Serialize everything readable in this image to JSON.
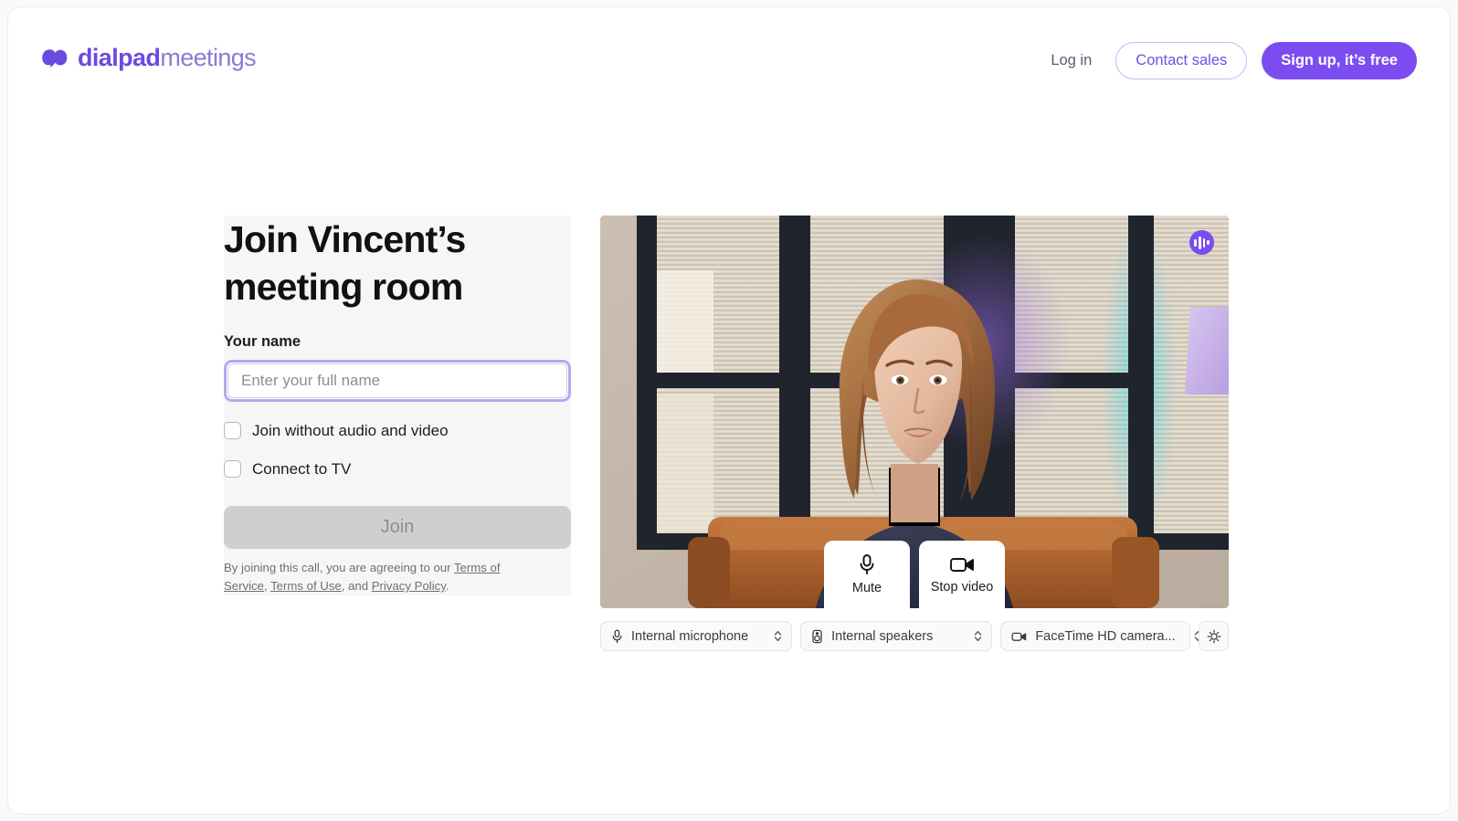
{
  "header": {
    "logo": {
      "icon": "dialpad-logo-icon",
      "bold_text": "dialpad",
      "light_text": "meetings"
    },
    "login_label": "Log in",
    "contact_sales_label": "Contact sales",
    "signup_label": "Sign up, it’s free"
  },
  "join_panel": {
    "title": "Join Vincent’s meeting room",
    "name_label": "Your name",
    "name_value": "",
    "name_placeholder": "Enter your full name",
    "checkboxes": [
      {
        "label": "Join without audio and video",
        "checked": false
      },
      {
        "label": "Connect to TV",
        "checked": false
      }
    ],
    "join_button_label": "Join",
    "join_button_enabled": false,
    "terms": {
      "intro": "By joining this call, you are agreeing to our",
      "link_terms_of_service": "Terms of Service",
      "separator_1": ", ",
      "link_terms_of_use": "Terms of Use",
      "separator_2": ", and ",
      "link_privacy_policy": "Privacy Policy",
      "end": "."
    }
  },
  "video": {
    "audio_indicator_icon": "audio-level-icon",
    "controls": [
      {
        "label": "Mute",
        "icon": "microphone-icon"
      },
      {
        "label": "Stop video",
        "icon": "video-camera-icon"
      }
    ],
    "devices": [
      {
        "icon": "microphone-icon",
        "value": "Internal microphone"
      },
      {
        "icon": "speaker-icon",
        "value": "Internal speakers"
      },
      {
        "icon": "camera-icon",
        "value": "FaceTime HD camera..."
      }
    ],
    "effects_button_icon": "video-effects-icon"
  },
  "colors": {
    "brand_purple": "#7b4df0",
    "logo_bold": "#6b4ae0",
    "logo_light": "#8d79d6",
    "focus_ring": "#b9a5ef",
    "panel_bg": "#f7f6f7",
    "page_bg": "#ffffff",
    "disabled_button": "#cfcfd0"
  }
}
